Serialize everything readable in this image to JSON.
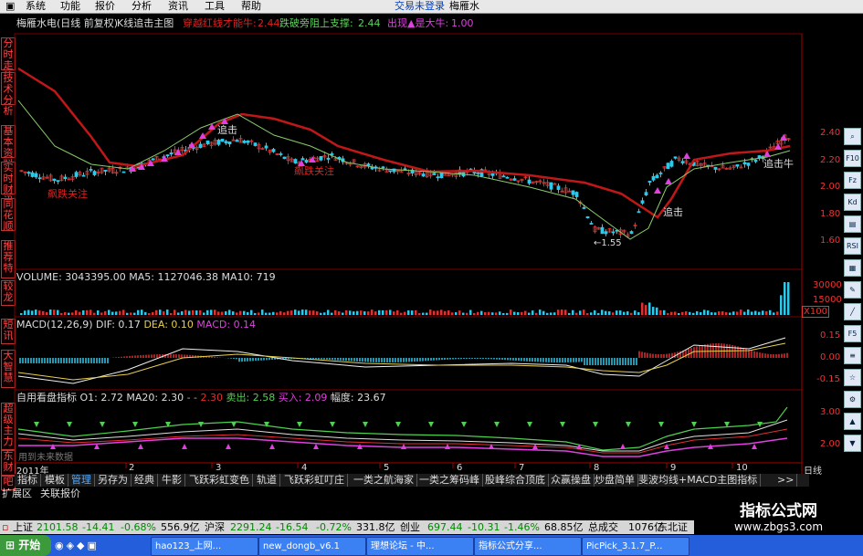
{
  "menu": {
    "items": [
      "系统",
      "功能",
      "报价",
      "分析",
      "资讯",
      "工具",
      "帮助"
    ],
    "trade": "交易未登录",
    "brand_right": "梅雁水"
  },
  "title": {
    "stock": "梅雁水电(日线 前复权)",
    "indicator": "K线追击主图",
    "s1_label": "穿越红线才能牛:",
    "s1_value": "2.44",
    "s2_label": "跌破旁阻上支撑:",
    "s2_value": "2.44",
    "s3_label": "出现▲是大牛:",
    "s3_value": "1.00"
  },
  "left_tabs": [
    "分时走势",
    "技术分析",
    "基本资料",
    "实时财讯",
    "同花顺",
    "推荐特",
    "较龙",
    "短讯",
    "大智慧",
    "超级主力",
    "东财",
    "吧"
  ],
  "main_chart": {
    "y_ticks": [
      "2.40",
      "2.20",
      "2.00",
      "1.80",
      "1.60"
    ],
    "annotations": [
      "飙跌关注",
      "追击",
      "追击",
      "飙跌关注",
      "追击",
      "追击牛"
    ],
    "low_label": "←1.55"
  },
  "volume": {
    "label": "VOLUME: 3043395.00",
    "ma5": "MA5: 1127046.38",
    "ma10": "MA10: 719",
    "y_ticks": [
      "30000",
      "15000"
    ],
    "unit": "X100"
  },
  "macd": {
    "label": "MACD(12,26,9)",
    "dif": "DIF: 0.17",
    "dea": "DEA: 0.10",
    "macd": "MACD: 0.14",
    "y_ticks": [
      "0.15",
      "0.00",
      "-0.15"
    ]
  },
  "custom": {
    "label": "自用看盘指标",
    "o1": "O1: 2.72",
    "ma20": "MA20: 2.30",
    "dash": "- -",
    "val": "2.30",
    "sell": "卖出: 2.58",
    "buy": "买入: 2.09",
    "range": "幅度: 23.67",
    "y_ticks": [
      "3.00",
      "2.00"
    ],
    "watermark": "用到未来数据"
  },
  "xaxis": {
    "year": "2011年",
    "months": [
      "2",
      "3",
      "4",
      "5",
      "6",
      "7",
      "8",
      "9",
      "10",
      "11"
    ],
    "period": "日线"
  },
  "tabs": [
    "指标",
    "模板",
    "管理",
    "另存为",
    "经典",
    "牛影",
    "飞跃彩虹变色",
    "轨道",
    "飞跃彩虹叮庄",
    "一类之航海家",
    "一类之筹码峰",
    "股峰综合顶底",
    "众赢操盘",
    "炒盘简单",
    "斐波均线+MACD主图指标",
    ">>"
  ],
  "tabs2": [
    "扩展区",
    "关联报价"
  ],
  "index_bar": {
    "sh_name": "上证",
    "sh_price": "2101.58",
    "sh_chg": "-14.41",
    "sh_pct": "-0.68%",
    "sh_amt": "556.9亿",
    "sz_name": "沪深",
    "sz_price": "2291.24",
    "sz_chg": "-16.54",
    "sz_pct": "-0.72%",
    "sz_amt": "331.8亿",
    "cy_name": "创业",
    "cy_price": "697.44",
    "cy_chg": "-10.31",
    "cy_pct": "-1.46%",
    "cy_amt": "68.85亿",
    "total_label": "总成交",
    "total": "1076亿",
    "extra": "东北证"
  },
  "taskbar": {
    "start": "开始",
    "items": [
      "hao123_上网...",
      "new_dongb_v6.1",
      "理想论坛 - 中...",
      "指标公式分享...",
      "PicPick_3.1.7_P..."
    ]
  },
  "watermark": {
    "cn": "指标公式网",
    "url": "www.zbgs3.com"
  },
  "right_tools": [
    "",
    "F10",
    "Fz",
    "Kd",
    "",
    "RSI",
    "",
    "",
    "",
    "F5"
  ],
  "colors": {
    "red_line": "#c01818",
    "green_line": "#8acb6a",
    "magenta": "#e040e0",
    "axis_red": "#e33333"
  }
}
